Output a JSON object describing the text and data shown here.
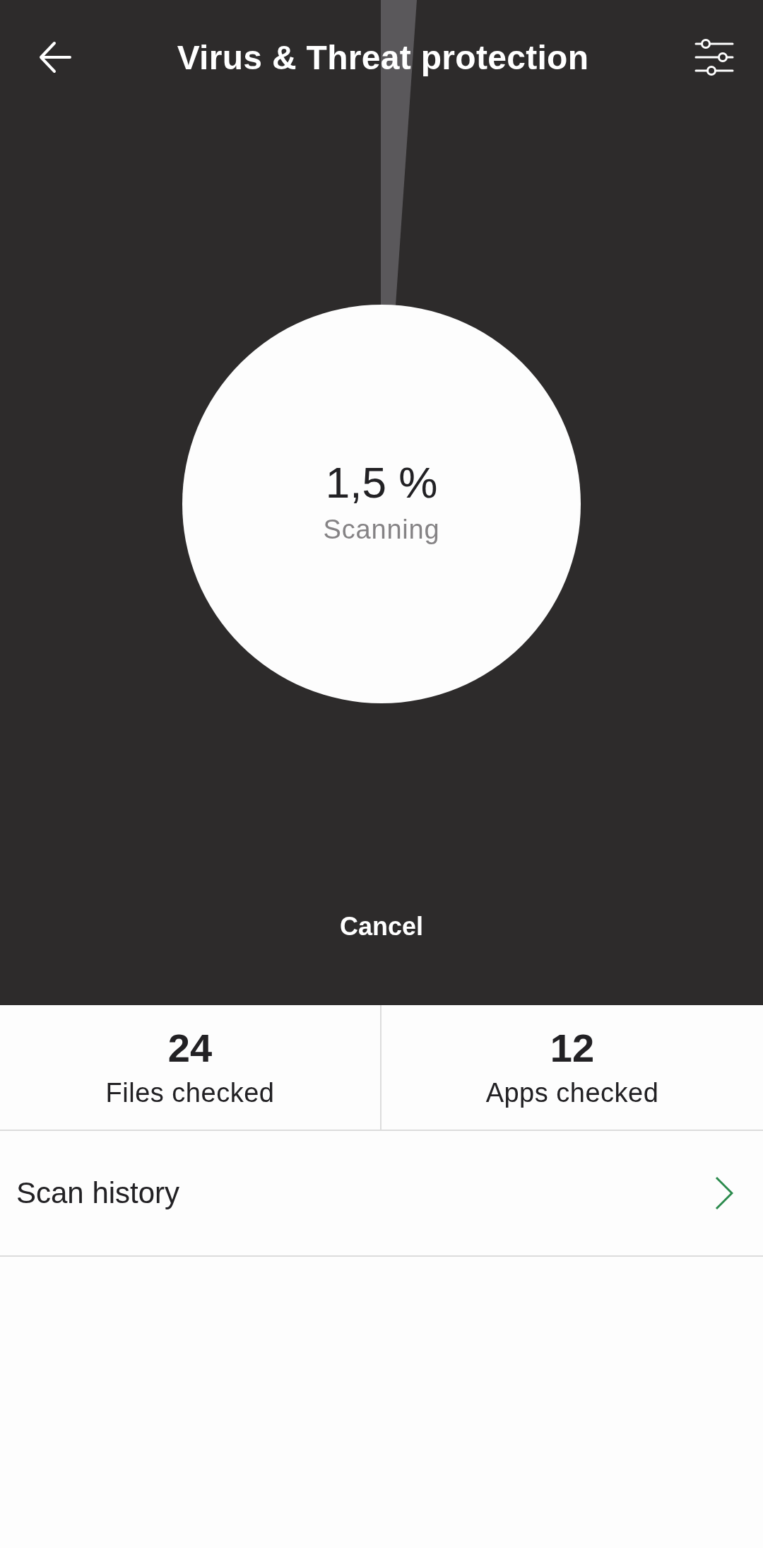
{
  "header": {
    "title": "Virus & Threat protection"
  },
  "scan": {
    "percent": "1,5 %",
    "status": "Scanning",
    "cancel": "Cancel"
  },
  "stats": [
    {
      "value": "24",
      "label": "Files checked"
    },
    {
      "value": "12",
      "label": "Apps checked"
    }
  ],
  "menu": [
    {
      "label": "Scan history"
    }
  ]
}
